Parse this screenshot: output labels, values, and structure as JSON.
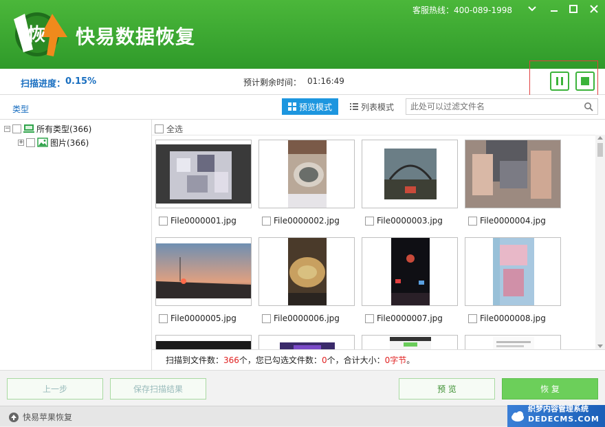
{
  "app": {
    "title": "快易数据恢复",
    "logo_char": "恢",
    "hotline": "客服热线：400-089-1998"
  },
  "window_controls": {
    "minimize_icon": "chevron-down-icon",
    "restore_icon": "minimize-icon",
    "maximize_icon": "maximize-icon",
    "close_icon": "close-icon"
  },
  "progress": {
    "label": "扫描进度：",
    "value": "0.15%",
    "remaining_label": "预计剩余时间：",
    "remaining_value": "01:16:49"
  },
  "controls": {
    "pause_icon": "pause-icon",
    "stop_icon": "stop-icon"
  },
  "toolbar": {
    "type_label": "类型",
    "preview_mode": "预览模式",
    "list_mode": "列表模式",
    "search_placeholder": "此处可以过滤文件名"
  },
  "tree": {
    "root": "所有类型(366)",
    "child": "图片(366)"
  },
  "grid": {
    "select_all": "全选",
    "files": [
      {
        "name": "File0000001.jpg"
      },
      {
        "name": "File0000002.jpg"
      },
      {
        "name": "File0000003.jpg"
      },
      {
        "name": "File0000004.jpg"
      },
      {
        "name": "File0000005.jpg"
      },
      {
        "name": "File0000006.jpg"
      },
      {
        "name": "File0000007.jpg"
      },
      {
        "name": "File0000008.jpg"
      }
    ]
  },
  "status": {
    "found_label": "扫描到文件数：",
    "found_count": "366",
    "found_unit": "个，您已勾选文件数：",
    "selected_count": "0",
    "selected_unit": "个，合计大小：",
    "size_value": "0字节",
    "end": "。"
  },
  "buttons": {
    "prev": "上一步",
    "save": "保存扫描结果",
    "preview": "预 览",
    "recover": "恢 复"
  },
  "footer": {
    "apple_link": "快易苹果恢复",
    "watermark_line1": "织梦内容管理系统",
    "watermark_line2": "DEDECMS.COM"
  },
  "colors": {
    "brand_green": "#3aa832",
    "accent_blue": "#1d96df",
    "alert_red": "#e02020"
  }
}
